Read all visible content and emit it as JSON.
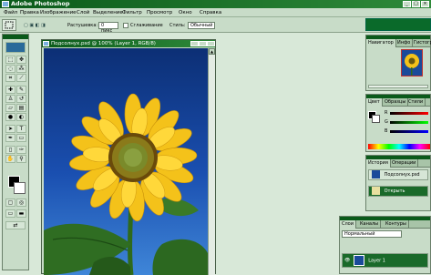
{
  "window": {
    "title": "Adobe Photoshop",
    "controls": [
      "_",
      "□",
      "×"
    ]
  },
  "menubar": {
    "items": [
      "Файл",
      "Правка",
      "Изображение",
      "Слой",
      "Выделение",
      "Фильтр",
      "Просмотр",
      "Окно",
      "Справка"
    ]
  },
  "options": {
    "feather_label": "Растушевка:",
    "feather_value": "0 пикс",
    "antialias_label": "Сглаживание",
    "style_label": "Стиль:",
    "style_value": "Обычный"
  },
  "document": {
    "title": "Подсолнух.psd @ 100% (Layer 1, RGB/8)"
  },
  "navigator_panel": {
    "tabs": [
      "Навигатор",
      "Инфо",
      "Гистограмма"
    ]
  },
  "color_panel": {
    "tabs": [
      "Цвет",
      "Образцы",
      "Стили"
    ],
    "channels": [
      "R",
      "G",
      "B"
    ]
  },
  "history_panel": {
    "tabs": [
      "История",
      "Операции"
    ],
    "items": [
      "Подсолнух.psd",
      "Открыть"
    ]
  },
  "layers_panel": {
    "tabs": [
      "Слои",
      "Каналы",
      "Контуры"
    ],
    "blend_mode": "Нормальный",
    "layer_name": "Layer 1"
  },
  "colors": {
    "accent": "#0a5a1a",
    "panel_bg": "#c8dcc8",
    "workspace": "#d8e8d8",
    "foreground_color": "#000000",
    "background_color": "#ffffff"
  }
}
